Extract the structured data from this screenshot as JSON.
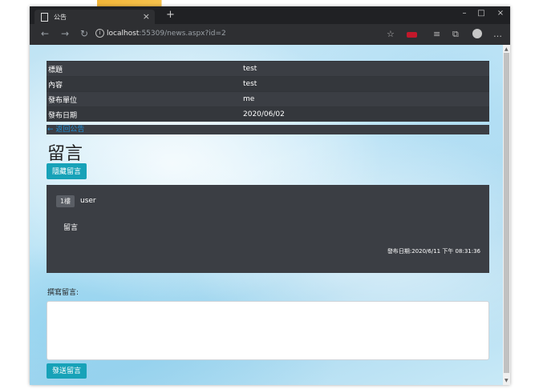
{
  "browser": {
    "tab_title": "公告",
    "tab_close": "×",
    "new_tab": "+",
    "url_host": "localhost",
    "url_rest": ":55309/news.aspx?id=2",
    "icons": [
      "document-icon",
      "back-arrow-icon",
      "forward-arrow-icon",
      "refresh-icon",
      "info-icon",
      "star-icon",
      "extension-icon",
      "favorites-icon",
      "collections-icon",
      "profile-icon",
      "more-icon"
    ],
    "window_controls": [
      "–",
      "□",
      "×"
    ]
  },
  "news": {
    "rows": [
      {
        "label": "標題",
        "value": "test"
      },
      {
        "label": "內容",
        "value": "test"
      },
      {
        "label": "發布單位",
        "value": "me"
      },
      {
        "label": "發布日期",
        "value": "2020/06/02"
      }
    ],
    "back_link": "← 返回公告"
  },
  "comments": {
    "heading": "留言",
    "hide_button": "隱藏留言",
    "items": [
      {
        "floor": "1樓",
        "user": "user",
        "body": "留言",
        "date": "發布日期:2020/6/11 下午 08:31:36"
      }
    ],
    "compose_label": "撰寫留言:",
    "send_button": "發送留言"
  },
  "colors": {
    "teal_button": "#17a2b8",
    "dark_panel": "#3b3e44",
    "link": "#1e8fd5"
  }
}
